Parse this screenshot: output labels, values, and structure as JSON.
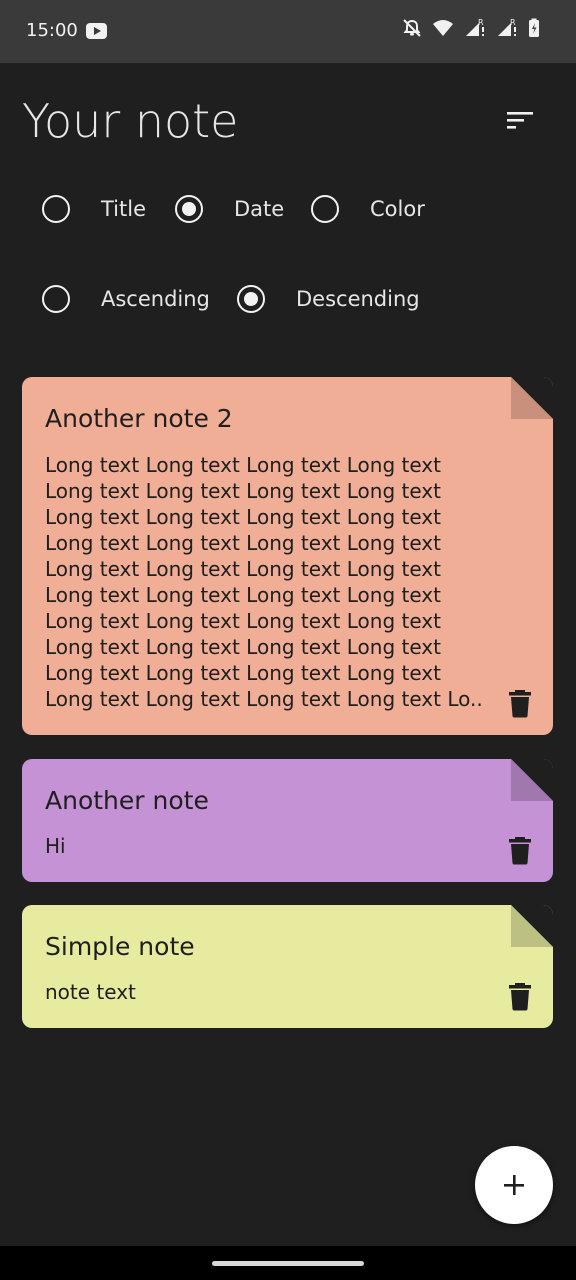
{
  "status_bar": {
    "time": "15:00",
    "icons": [
      "youtube-icon",
      "alarm-off-icon",
      "wifi-icon",
      "signal-icon",
      "signal-icon",
      "battery-icon"
    ]
  },
  "header": {
    "title": "Your note",
    "sort_icon": "sort-icon"
  },
  "sort_by": {
    "options": [
      {
        "label": "Title",
        "checked": false
      },
      {
        "label": "Date",
        "checked": true
      },
      {
        "label": "Color",
        "checked": false
      }
    ]
  },
  "order": {
    "options": [
      {
        "label": "Ascending",
        "checked": false
      },
      {
        "label": "Descending",
        "checked": true
      }
    ]
  },
  "notes": [
    {
      "title": "Another note 2",
      "lines": [
        "Long text Long text Long text Long text",
        "Long text Long text Long text Long text",
        "Long text Long text Long text Long text",
        "Long text Long text Long text Long text",
        "Long text Long text Long text Long text",
        "Long text Long text Long text Long text",
        "Long text Long text Long text Long text",
        "Long text Long text Long text Long text",
        "Long text Long text Long text Long text",
        "Long text Long text Long text Long text Lo..."
      ],
      "color": "#f0ae96",
      "fold_color": "#c9907c"
    },
    {
      "title": "Another note",
      "content": "Hi",
      "color": "#c592d6",
      "fold_color": "#a078ae"
    },
    {
      "title": "Simple note",
      "content": "note text",
      "color": "#e6eba0",
      "fold_color": "#bcc083"
    }
  ],
  "fab": {
    "icon": "plus-icon"
  },
  "colors": {
    "background": "#1f1f1f",
    "status_bar": "#3a3a3a"
  }
}
